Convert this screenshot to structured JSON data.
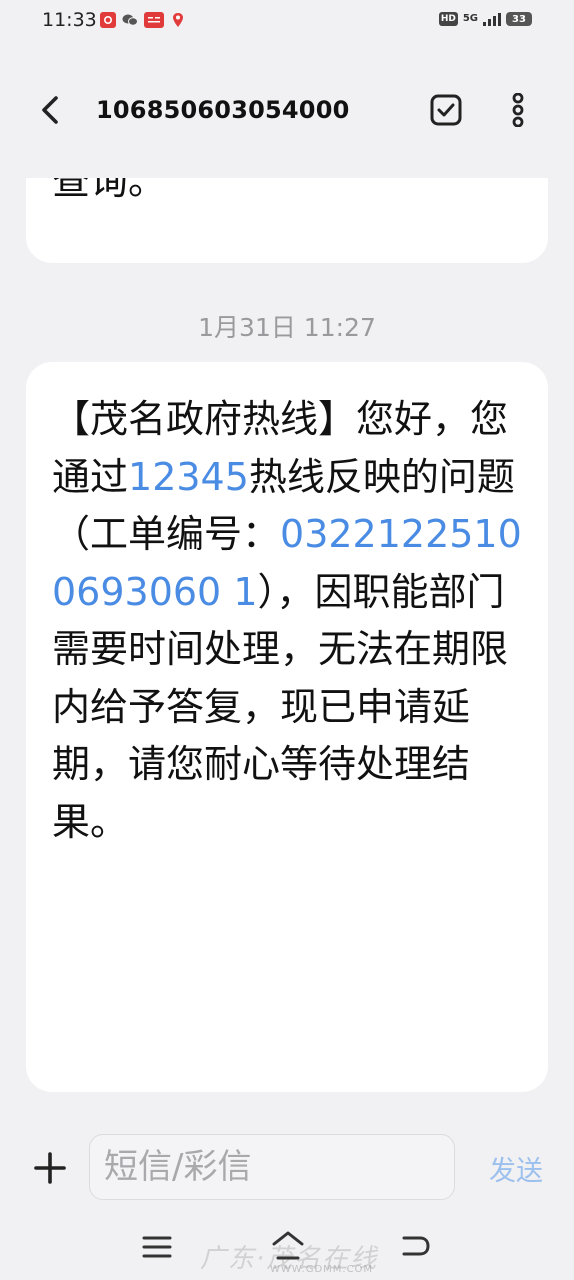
{
  "status_bar": {
    "time": "11:33",
    "network": "5G",
    "hd": "HD",
    "battery": "33",
    "app_icons": [
      "netease-music-icon",
      "wechat-icon",
      "toutiao-icon",
      "location-icon"
    ]
  },
  "header": {
    "title": "106850603054000",
    "icons": {
      "back": "chevron-left-icon",
      "select": "checkbox-icon",
      "more": "more-vertical-icon"
    }
  },
  "conversation": {
    "previous_message_tail": "查询。",
    "timestamp": "1月31日 11:27",
    "message": {
      "part1": "【茂名政府热线】您好，您通过",
      "hotline_number": "12345",
      "part2": "热线反映的问题（工单编号：",
      "ticket_number": "03221225100693060 1",
      "part3": "），因职能部门需要时间处理，无法在期限内给予答复，现已申请延期，请您耐心等待处理结果。"
    }
  },
  "composer": {
    "placeholder": "短信/彩信",
    "send_label": "发送"
  },
  "watermark": {
    "text": "广东·茂名在线",
    "url": "WWW.GDMM.COM"
  },
  "colors": {
    "background": "#f1f1f3",
    "bubble": "#ffffff",
    "link": "#4a8be3",
    "timestamp": "#9a9a9e",
    "send_disabled": "#9cc0ee"
  }
}
